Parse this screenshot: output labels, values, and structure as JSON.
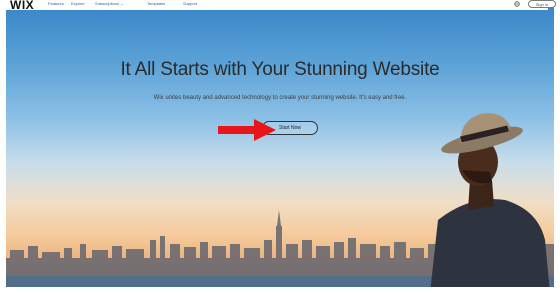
{
  "nav": {
    "logo": "WIX",
    "items": [
      "Features",
      "Explore",
      "Subscriptions ⌄",
      "Templates",
      "Support"
    ],
    "signin_label": "Sign In"
  },
  "hero": {
    "headline": "It All Starts with Your Stunning Website",
    "subtitle": "Wix unites beauty and advanced technology to create your stunning website. It's easy and free.",
    "cta_label": "Start Now"
  },
  "annotation": {
    "arrow_color": "#e8161b"
  },
  "icons": {
    "language": "globe-icon"
  }
}
